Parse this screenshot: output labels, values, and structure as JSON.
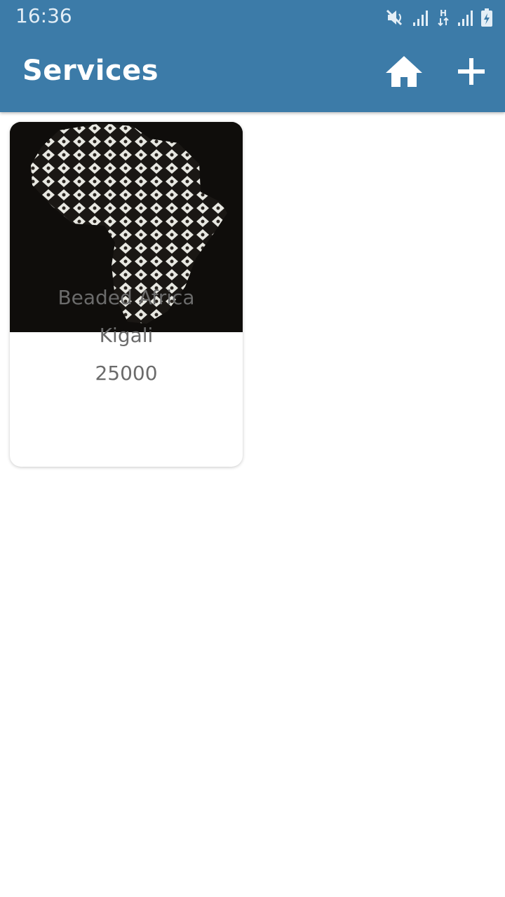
{
  "status_bar": {
    "time": "16:36",
    "icons": [
      "mute-icon",
      "signal-icon",
      "network-h-icon",
      "signal-icon",
      "battery-charging-icon"
    ]
  },
  "app_bar": {
    "title": "Services",
    "home_icon": "home-icon",
    "add_icon": "add-icon"
  },
  "services": [
    {
      "name": "Beaded Africa",
      "location": "Kigali",
      "price": "25000",
      "image": "beaded-africa-map-photo"
    }
  ],
  "colors": {
    "primary": "#3c7ba8",
    "card_text": "#6b6b6b",
    "background": "#ffffff"
  }
}
